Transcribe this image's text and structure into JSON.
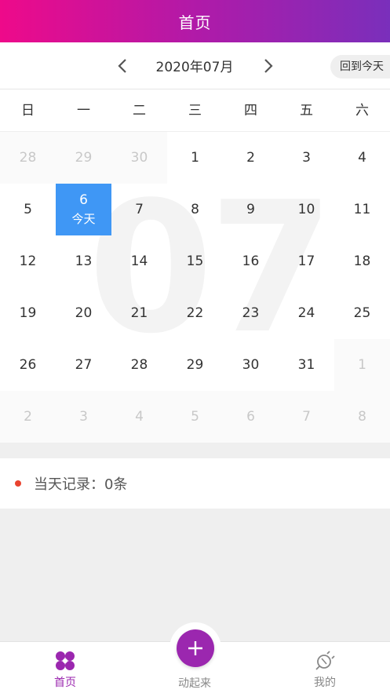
{
  "header": {
    "title": "首页"
  },
  "month_bar": {
    "month_label": "2020年07月",
    "today_button": "回到今天"
  },
  "weekdays": [
    "日",
    "一",
    "二",
    "三",
    "四",
    "五",
    "六"
  ],
  "calendar": {
    "watermark": "07",
    "today_label": "今天",
    "weeks": [
      [
        {
          "d": "28",
          "other": true
        },
        {
          "d": "29",
          "other": true
        },
        {
          "d": "30",
          "other": true
        },
        {
          "d": "1"
        },
        {
          "d": "2"
        },
        {
          "d": "3"
        },
        {
          "d": "4"
        }
      ],
      [
        {
          "d": "5"
        },
        {
          "d": "6",
          "today": true
        },
        {
          "d": "7"
        },
        {
          "d": "8"
        },
        {
          "d": "9"
        },
        {
          "d": "10"
        },
        {
          "d": "11"
        }
      ],
      [
        {
          "d": "12"
        },
        {
          "d": "13"
        },
        {
          "d": "14"
        },
        {
          "d": "15"
        },
        {
          "d": "16"
        },
        {
          "d": "17"
        },
        {
          "d": "18"
        }
      ],
      [
        {
          "d": "19"
        },
        {
          "d": "20"
        },
        {
          "d": "21"
        },
        {
          "d": "22"
        },
        {
          "d": "23"
        },
        {
          "d": "24"
        },
        {
          "d": "25"
        }
      ],
      [
        {
          "d": "26"
        },
        {
          "d": "27"
        },
        {
          "d": "28"
        },
        {
          "d": "29"
        },
        {
          "d": "30"
        },
        {
          "d": "31"
        },
        {
          "d": "1",
          "other": true
        }
      ],
      [
        {
          "d": "2",
          "other": true
        },
        {
          "d": "3",
          "other": true
        },
        {
          "d": "4",
          "other": true
        },
        {
          "d": "5",
          "other": true
        },
        {
          "d": "6",
          "other": true
        },
        {
          "d": "7",
          "other": true
        },
        {
          "d": "8",
          "other": true
        }
      ]
    ]
  },
  "record": {
    "text": "当天记录：0条"
  },
  "tabbar": {
    "home": "首页",
    "center": "动起来",
    "mine": "我的"
  },
  "colors": {
    "accent": "#9b27af",
    "today": "#3f97f5",
    "dot": "#e9432f"
  }
}
